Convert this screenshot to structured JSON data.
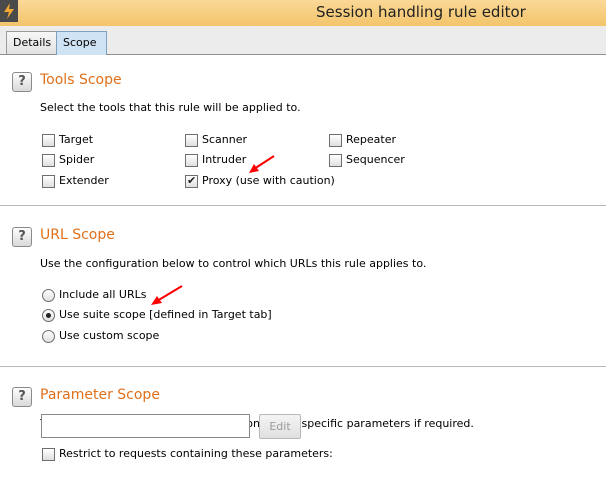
{
  "window": {
    "title": "Session handling rule editor"
  },
  "tabs": [
    {
      "label": "Details"
    },
    {
      "label": "Scope"
    }
  ],
  "tools_scope": {
    "title": "Tools Scope",
    "help": "?",
    "description": "Select the tools that this rule will be applied to.",
    "options": [
      {
        "label": "Target",
        "checked": false
      },
      {
        "label": "Scanner",
        "checked": false
      },
      {
        "label": "Repeater",
        "checked": false
      },
      {
        "label": "Spider",
        "checked": false
      },
      {
        "label": "Intruder",
        "checked": false
      },
      {
        "label": "Sequencer",
        "checked": false
      },
      {
        "label": "Extender",
        "checked": false
      },
      {
        "label": "Proxy (use with caution)",
        "checked": true
      }
    ]
  },
  "url_scope": {
    "title": "URL Scope",
    "help": "?",
    "description": "Use the configuration below to control which URLs this rule applies to.",
    "options": [
      {
        "label": "Include all URLs",
        "selected": false
      },
      {
        "label": "Use suite scope [defined in Target tab]",
        "selected": true
      },
      {
        "label": "Use custom scope",
        "selected": false
      }
    ]
  },
  "parameter_scope": {
    "title": "Parameter Scope",
    "help": "?",
    "description": "You can restrict the rule to requests containing specific parameters if required.",
    "restrict_label": "Restrict to requests containing these parameters:",
    "restrict_checked": false,
    "parameters_value": "",
    "edit_label": "Edit"
  },
  "colors": {
    "section_title": "#e0701a",
    "annotation_arrow": "#ff0000",
    "titlebar": "#f3c46b"
  },
  "icons": [
    "app-icon",
    "help-icon",
    "annotation-arrow"
  ]
}
